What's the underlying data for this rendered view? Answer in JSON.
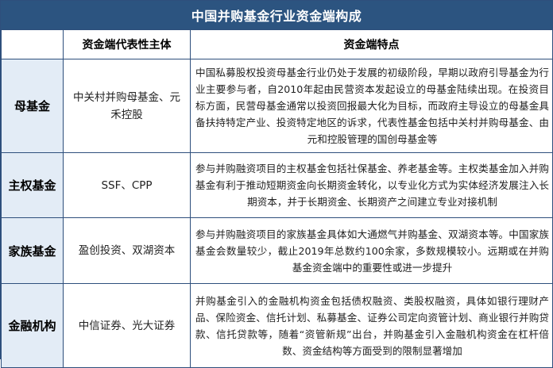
{
  "title": "中国并购基金行业资金端构成",
  "headers": {
    "category": "",
    "representative": "资金端代表性主体",
    "features": "资金端特点"
  },
  "rows": [
    {
      "category": "母基金",
      "representative": "中关村并购母基金、元禾控股",
      "features": "中国私募股权投资母基金行业仍处于发展的初级阶段，早期以政府引导基金为行业主要参与者，自2010年起由民营资本发起设立的母基金陆续出现。在投资目标方面，民营母基金通常以投资回报最大化为目标，而政府主导设立的母基金具备扶持特定产业、投资特定地区的诉求，代表性基金包括中关村并购母基金、由元和控股管理的国创母基金等"
    },
    {
      "category": "主权基金",
      "representative": "SSF、CPP",
      "features": "参与并购融资项目的主权基金包括社保基金、养老基金等。主权类基金加入并购基金有利于推动短期资金向长期资金转化，以专业化方式为实体经济发展注入长期资本，并于长期资金、长期资产之间建立专业对接机制"
    },
    {
      "category": "家族基金",
      "representative": "盈创投资、双湖资本",
      "features": "参与并购融资项目的家族基金具体如大通燃气并购基金、双湖资本等。中国家族基金会数量较少，截止2019年总数约100余家，多数规模较小。远期或在并购基金资金端中的重要性或进一步提升"
    },
    {
      "category": "金融机构",
      "representative": "中信证券、光大证券",
      "features": "并购基金引入的金融机构资金包括债权融资、类股权融资，具体如银行理财产品、保险资金、信托计划、私募基金、证券公司定向资管计划、商业银行并购贷款、信托贷款等，随着“资管新规”出台，并购基金引入金融机构资金在杠杆倍数、资金结构等方面受到的限制显著增加"
    }
  ]
}
